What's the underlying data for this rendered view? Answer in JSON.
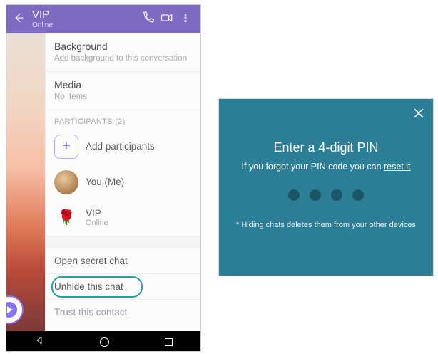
{
  "phone": {
    "header": {
      "title": "VIP",
      "status": "Online"
    },
    "sections": {
      "background": {
        "title": "Background",
        "sub": "Add background to this conversation"
      },
      "media": {
        "title": "Media",
        "sub": "No Items"
      }
    },
    "participants_header": "PARTICIPANTS (2)",
    "add_label": "Add participants",
    "participants": [
      {
        "name": "You (Me)",
        "sub": ""
      },
      {
        "name": "VIP",
        "sub": "Online"
      }
    ],
    "actions": {
      "open_secret": "Open secret chat",
      "unhide": "Unhide this chat",
      "trust": "Trust this contact"
    }
  },
  "dialog": {
    "title": "Enter a 4-digit PIN",
    "sub_pre": "If you forgot your PIN code you can ",
    "reset": "reset it",
    "footer": "* Hiding chats deletes them from your other devices"
  }
}
